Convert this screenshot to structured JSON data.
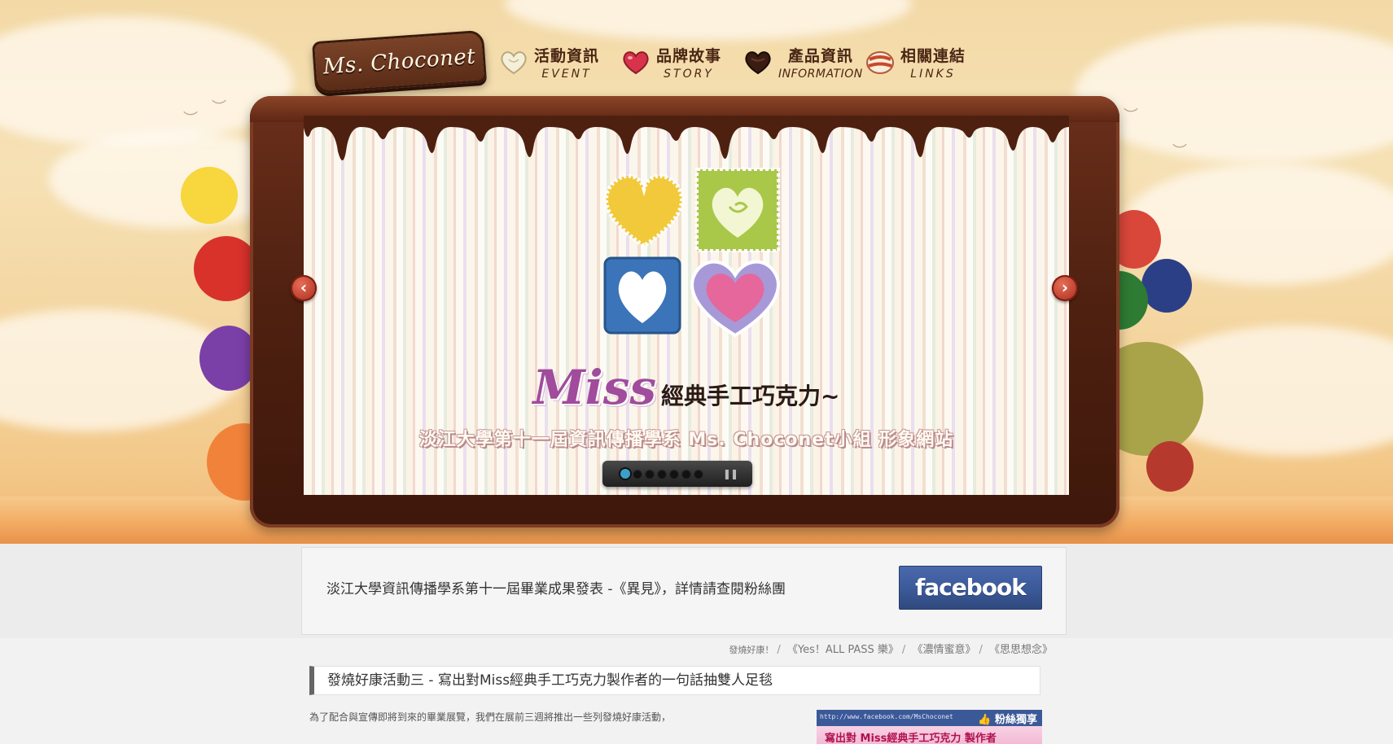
{
  "logo": {
    "text": "Ms. Choconet"
  },
  "nav": [
    {
      "zh": "活動資訊",
      "en": "EVENT",
      "icon": "white-chocolate-heart-icon"
    },
    {
      "zh": "品牌故事",
      "en": "STORY",
      "icon": "red-heart-icon"
    },
    {
      "zh": "產品資訊",
      "en": "INFORMATION",
      "icon": "dark-chocolate-heart-icon"
    },
    {
      "zh": "相關連結",
      "en": "LINKS",
      "icon": "striped-candy-icon"
    }
  ],
  "slider": {
    "title_miss": "Miss",
    "title_sub": "經典手工巧克力~",
    "caption": "淡江大學第十一屆資訊傳播學系 Ms. Choconet小組 形象網站",
    "dots": 7,
    "active_dot": 0,
    "prev_label": "‹",
    "next_label": "›",
    "pause_label": "❚❚"
  },
  "banner": {
    "text": "淡江大學資訊傳播學系第十一屆畢業成果發表 -《異見》，詳情請查閱粉絲團",
    "facebook_label": "facebook"
  },
  "breadcrumb": [
    "發燒好康！",
    "《Yes！ALL PASS 樂》",
    "《濃情蜜意》",
    "《思思想念》"
  ],
  "article": {
    "title": "發燒好康活動三 - 寫出對Miss經典手工巧克力製作者的一句話抽雙人足毯",
    "body": "為了配合與宣傳即將到來的畢業展覽，我們在展前三週將推出一些列發燒好康活動，",
    "fan_card": {
      "url": "http://www.facebook.com/MsChoconet",
      "badge": "👍 粉絲獨享",
      "strip": "寫出對 Miss經典手工巧克力 製作者"
    }
  },
  "colors": {
    "chocolate": "#4e2010",
    "facebook_blue": "#3b5998",
    "accent_purple": "#a04b9c"
  }
}
